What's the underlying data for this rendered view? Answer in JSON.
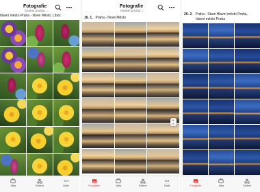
{
  "accent_color": "#e53935",
  "panel1": {
    "title": "Fotografie",
    "subtitle": "Osobní prostor",
    "date_row": "hlavní město Praha - Nové Město, Liboc",
    "tabs": [
      {
        "label": "Alba",
        "icon": "albums-icon"
      },
      {
        "label": "Sdílení",
        "icon": "sharing-icon"
      },
      {
        "label": "Další",
        "icon": "more-icon"
      }
    ]
  },
  "panel2": {
    "title": "Fotografie",
    "subtitle": "Osobní prostor",
    "date": "16. 1.",
    "place": "Praha - Nové Město",
    "tabs": [
      {
        "label": "Fotografie",
        "icon": "photos-icon",
        "active": true
      },
      {
        "label": "Alba",
        "icon": "albums-icon"
      },
      {
        "label": "Sdílení",
        "icon": "sharing-icon"
      },
      {
        "label": "Další",
        "icon": "more-icon"
      }
    ]
  },
  "panel3": {
    "date": "20. 2.",
    "place_line1": "Praha - Staré Hlavní město Praha,",
    "place_line2": "hlavní město Praha",
    "tabs": [
      {
        "label": "Fotografie",
        "icon": "photos-icon",
        "active": true
      },
      {
        "label": "Alba",
        "icon": "albums-icon"
      },
      {
        "label": "Sdílení",
        "icon": "sharing-icon"
      }
    ]
  }
}
